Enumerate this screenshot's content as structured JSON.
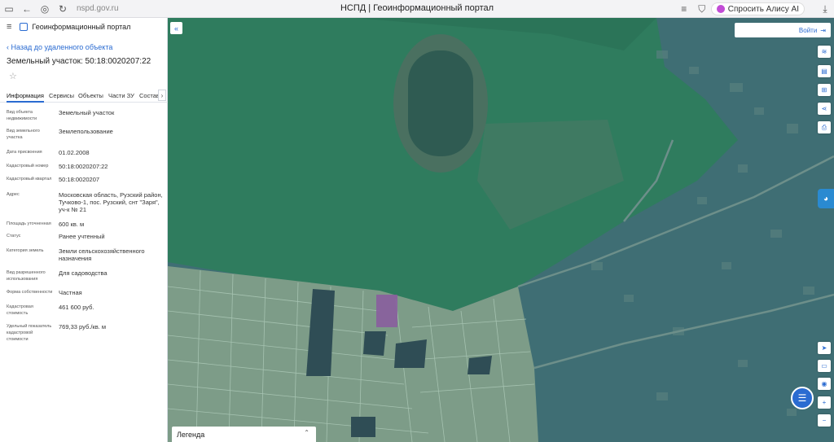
{
  "browser": {
    "url": "nspd.gov.ru",
    "tab_title": "НСПД | Геоинформационный портал",
    "alice_label": "Спросить Алису AI"
  },
  "sidebar": {
    "portal_title": "Геоинформационный портал",
    "back_link": "Назад до удаленного объекта",
    "parcel_title": "Земельный участок: 50:18:0020207:22",
    "tabs": [
      "Информация",
      "Сервисы",
      "Объекты",
      "Части ЗУ",
      "Состав"
    ],
    "rows": [
      {
        "label": "Вид объекта недвижимости",
        "value": "Земельный участок"
      },
      {
        "label": "Вид земельного участка",
        "value": "Землепользование"
      },
      {
        "label": "Дата присвоения",
        "value": "01.02.2008"
      },
      {
        "label": "Кадастровый номер",
        "value": "50:18:0020207:22"
      },
      {
        "label": "Кадастровый квартал",
        "value": "50:18:0020207"
      },
      {
        "label": "Адрес",
        "value": "Московская область, Рузский район, Тучково-1, пос. Рузский, снт \"Заря\", уч-к № 21"
      },
      {
        "label": "Площадь уточненная",
        "value": "600 кв. м"
      },
      {
        "label": "Статус",
        "value": "Ранее учтенный"
      },
      {
        "label": "Категория земель",
        "value": "Земли сельскохозяйственного назначения"
      },
      {
        "label": "Вид разрешенного использования",
        "value": "Для садоводства"
      },
      {
        "label": "Форма собственности",
        "value": "Частная"
      },
      {
        "label": "Кадастровая стоимость",
        "value": "461 600 руб."
      },
      {
        "label": "Удельный показатель кадастровой стоимости",
        "value": "769,33 руб./кв. м"
      }
    ]
  },
  "map": {
    "login_label": "Войти",
    "legend_label": "Легенда",
    "colors": {
      "forest": "#2e7a5c",
      "parcels": "#7a9a86",
      "urban": "#3d6d72",
      "selected_parcel": "#8a5aa0",
      "accent": "#2a6bd1"
    }
  }
}
